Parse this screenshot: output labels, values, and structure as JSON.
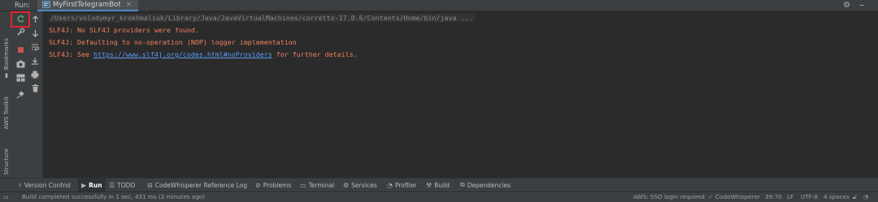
{
  "header": {
    "run_label": "Run:",
    "run_tab": "MyFirstTelegramBot",
    "settings_icon": "gear-icon",
    "hide_icon": "minus-icon"
  },
  "left_strip": {
    "bookmarks": "Bookmarks",
    "aws_toolkit": "AWS Toolkit",
    "structure": "Structure"
  },
  "toolbar": {
    "buttons": [
      "rerun",
      "modify-config",
      "stop",
      "dump-threads",
      "settings",
      "pin"
    ],
    "side_buttons": [
      "scroll-up",
      "scroll-down",
      "soft-wrap",
      "scroll-to-end",
      "print",
      "clear-all"
    ]
  },
  "console": {
    "command": "/Users/volodymyr_krokhmaliuk/Library/Java/JavaVirtualMachines/corretto-17.0.6/Contents/Home/bin/java ...",
    "lines": [
      "SLF4J: No SLF4J providers were found.",
      "SLF4J: Defaulting to no-operation (NOP) logger implementation"
    ],
    "line3_prefix": "SLF4J: See ",
    "line3_link": "https://www.slf4j.org/codes.html#noProviders",
    "line3_suffix": " for further details."
  },
  "tool_tabs": [
    {
      "label": "Version Control",
      "icon": "version-control-icon"
    },
    {
      "label": "Run",
      "icon": "run-icon",
      "active": true
    },
    {
      "label": "TODO",
      "icon": "list-icon"
    },
    {
      "label": "CodeWhisperer Reference Log",
      "icon": "codewhisperer-icon"
    },
    {
      "label": "Problems",
      "icon": "problems-icon"
    },
    {
      "label": "Terminal",
      "icon": "terminal-icon"
    },
    {
      "label": "Services",
      "icon": "services-icon"
    },
    {
      "label": "Profiler",
      "icon": "profiler-icon"
    },
    {
      "label": "Build",
      "icon": "hammer-icon"
    },
    {
      "label": "Dependencies",
      "icon": "dependencies-icon"
    }
  ],
  "status": {
    "message": "Build completed successfully in 1 sec, 431 ms (2 minutes ago)",
    "aws": "AWS: SSO login required",
    "codewhisperer": "CodeWhisperer",
    "position": "39:70",
    "line_sep": "LF",
    "encoding": "UTF-8",
    "indent": "4 spaces"
  },
  "colors": {
    "error_text": "#f0805e",
    "link": "#589df6",
    "highlight": "#e3242b",
    "accent": "#4a88c7"
  }
}
